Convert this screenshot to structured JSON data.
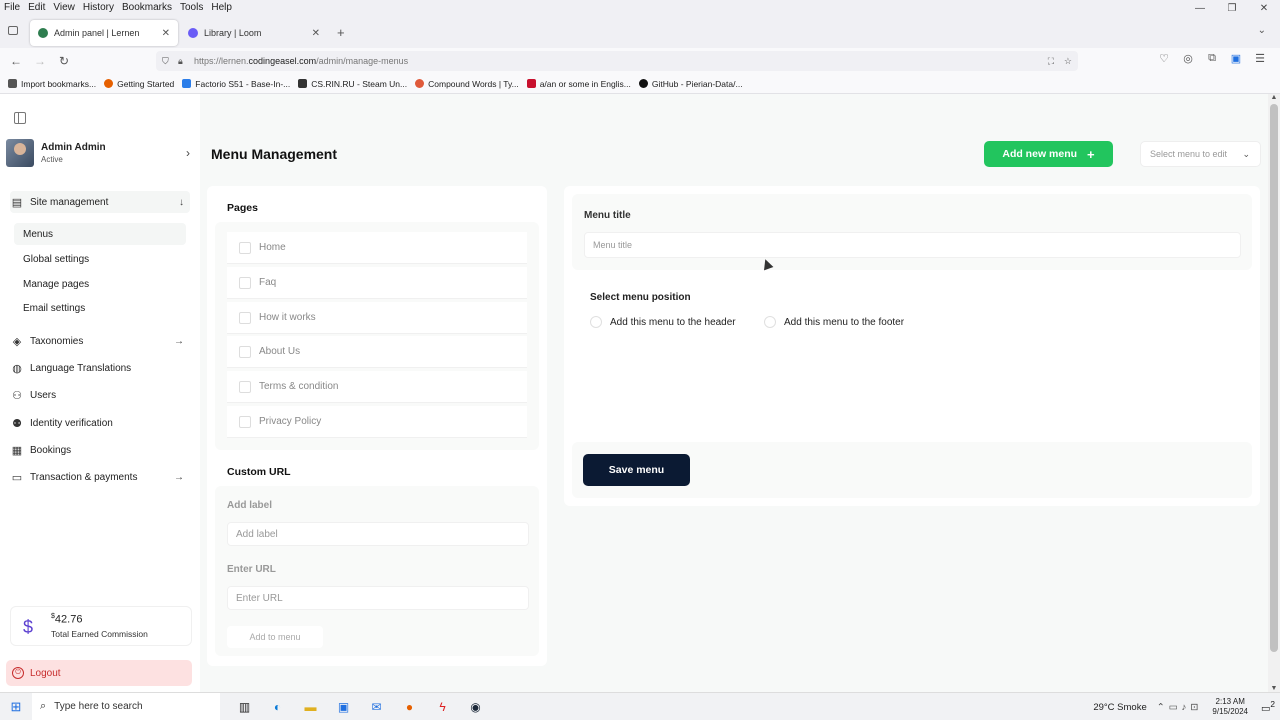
{
  "browser": {
    "menu": [
      "File",
      "Edit",
      "View",
      "History",
      "Bookmarks",
      "Tools",
      "Help"
    ],
    "tabs": [
      {
        "title": "Admin panel | Lernen"
      },
      {
        "title": "Library | Loom"
      }
    ],
    "url_prefix": "https://lernen.",
    "url_domain": "codingeasel.com",
    "url_path": "/admin/manage-menus",
    "bookmarks": [
      {
        "label": "Import bookmarks...",
        "color": "#555555"
      },
      {
        "label": "Getting Started",
        "color": "#e66000"
      },
      {
        "label": "Factorio S51 - Base-In-...",
        "color": "#2b7de9"
      },
      {
        "label": "CS.RIN.RU - Steam Un...",
        "color": "#333333"
      },
      {
        "label": "Compound Words | Ty...",
        "color": "#e05a3a"
      },
      {
        "label": "a/an or some in Englis...",
        "color": "#c8102e"
      },
      {
        "label": "GitHub - Pierian-Data/...",
        "color": "#111111"
      }
    ]
  },
  "sidebar": {
    "profile_name": "Admin Admin",
    "profile_status": "Active",
    "site_management": "Site management",
    "sub_items": [
      "Menus",
      "Global settings",
      "Manage pages",
      "Email settings"
    ],
    "items": [
      {
        "label": "Taxonomies",
        "icon": "layers-icon"
      },
      {
        "label": "Language Translations",
        "icon": "globe-icon"
      },
      {
        "label": "Users",
        "icon": "users-icon"
      },
      {
        "label": "Identity verification",
        "icon": "user-check-icon"
      },
      {
        "label": "Bookings",
        "icon": "document-icon"
      },
      {
        "label": "Transaction & payments",
        "icon": "card-icon"
      }
    ],
    "commission_currency": "$",
    "commission_amount": "42.76",
    "commission_label": "Total Earned Commission",
    "logout": "Logout"
  },
  "main": {
    "title": "Menu Management",
    "add_button": "Add new menu",
    "select_placeholder": "Select menu to edit",
    "pages_title": "Pages",
    "pages": [
      "Home",
      "Faq",
      "How it works",
      "About Us",
      "Terms & condition",
      "Privacy Policy"
    ],
    "custom_url_title": "Custom URL",
    "add_label_title": "Add label",
    "add_label_placeholder": "Add label",
    "enter_url_title": "Enter URL",
    "enter_url_placeholder": "Enter URL",
    "add_to_menu": "Add to menu",
    "menu_title_label": "Menu title",
    "menu_title_placeholder": "Menu title",
    "position_title": "Select menu position",
    "position_header": "Add this menu to the header",
    "position_footer": "Add this menu to the footer",
    "save_button": "Save menu"
  },
  "taskbar": {
    "search": "Type here to search",
    "weather": "29°C  Smoke",
    "time": "2:13 AM",
    "date": "9/15/2024",
    "notifications": "2"
  },
  "colors": {
    "accent_green": "#22c55e",
    "save_navy": "#0b1a33",
    "logout_bg": "#fde1e1",
    "logout_text": "#c72d2d"
  }
}
